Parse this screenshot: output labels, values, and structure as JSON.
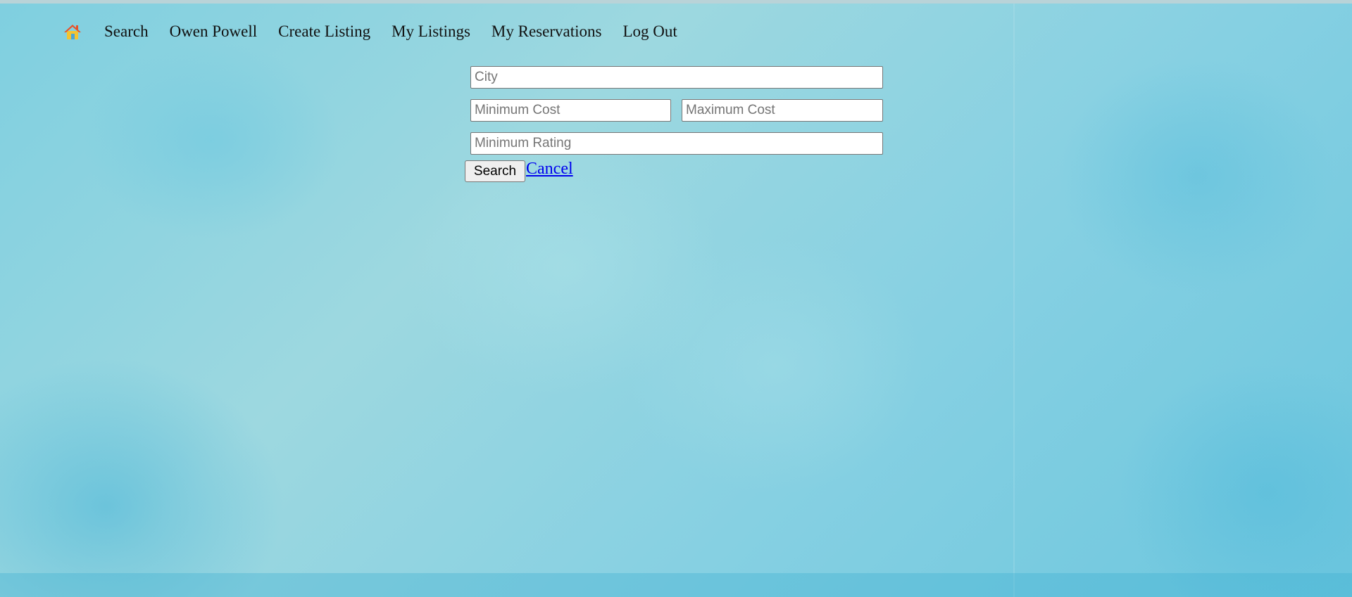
{
  "nav": {
    "home_icon": "home-icon",
    "items": [
      {
        "label": "Search"
      },
      {
        "label": "Owen Powell"
      },
      {
        "label": "Create Listing"
      },
      {
        "label": "My Listings"
      },
      {
        "label": "My Reservations"
      },
      {
        "label": "Log Out"
      }
    ]
  },
  "search_form": {
    "city_placeholder": "City",
    "min_cost_placeholder": "Minimum Cost",
    "max_cost_placeholder": "Maximum Cost",
    "min_rating_placeholder": "Minimum Rating",
    "search_label": "Search",
    "cancel_label": "Cancel"
  },
  "colors": {
    "background": "#9dd8e0",
    "link": "#0000ee",
    "home_roof": "#e8522a",
    "home_walls": "#f4c431"
  }
}
